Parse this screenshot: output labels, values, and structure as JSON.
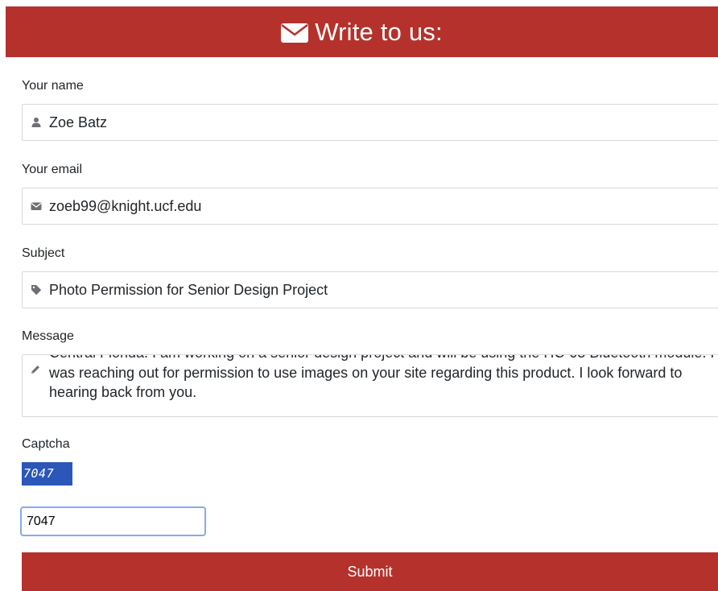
{
  "header": {
    "icon": "envelope-icon",
    "title": "Write to us:"
  },
  "form": {
    "name": {
      "label": "Your name",
      "icon": "user-icon",
      "value": "Zoe Batz"
    },
    "email": {
      "label": "Your email",
      "icon": "envelope-icon",
      "value": "zoeb99@knight.ucf.edu"
    },
    "subject": {
      "label": "Subject",
      "icon": "tag-icon",
      "value": "Photo Permission for Senior Design Project"
    },
    "message": {
      "label": "Message",
      "icon": "pencil-icon",
      "value": "Central Florida. I am working on a senior design project and will be using the HC-05 Bluetooth module. I was reaching out for permission to use images on your site regarding this product. I look forward to hearing back from you."
    },
    "captcha": {
      "label": "Captcha",
      "image_text": "7047",
      "input_value": "7047"
    },
    "submit_label": "Submit"
  },
  "colors": {
    "accent": "#b5322c",
    "captcha_bg": "#2b57b8",
    "focus_border": "#8aa9ec"
  }
}
